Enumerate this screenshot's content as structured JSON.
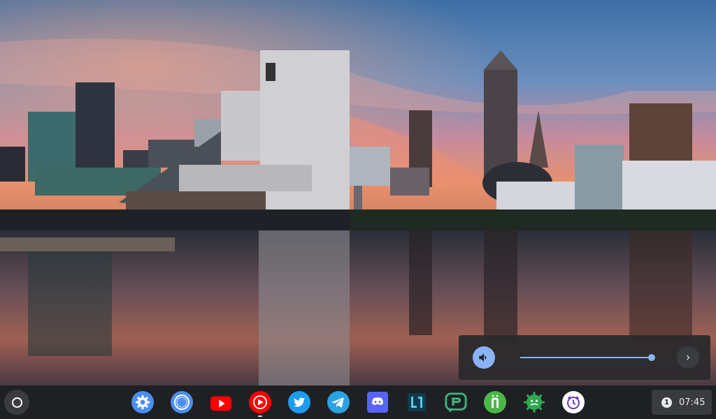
{
  "volume": {
    "level": 0.99
  },
  "shelf": {
    "apps": [
      {
        "name": "settings-app"
      },
      {
        "name": "chrome-app"
      },
      {
        "name": "youtube-app"
      },
      {
        "name": "youtube-music-app"
      },
      {
        "name": "twitter-app"
      },
      {
        "name": "telegram-app"
      },
      {
        "name": "discord-app"
      },
      {
        "name": "l1-app"
      },
      {
        "name": "pushbullet-app"
      },
      {
        "name": "n-app"
      },
      {
        "name": "android-app"
      },
      {
        "name": "clock-app"
      }
    ],
    "notification_count": "1",
    "time": "07:45"
  },
  "colors": {
    "accent": "#8ab4f8",
    "shelf": "#202124"
  }
}
